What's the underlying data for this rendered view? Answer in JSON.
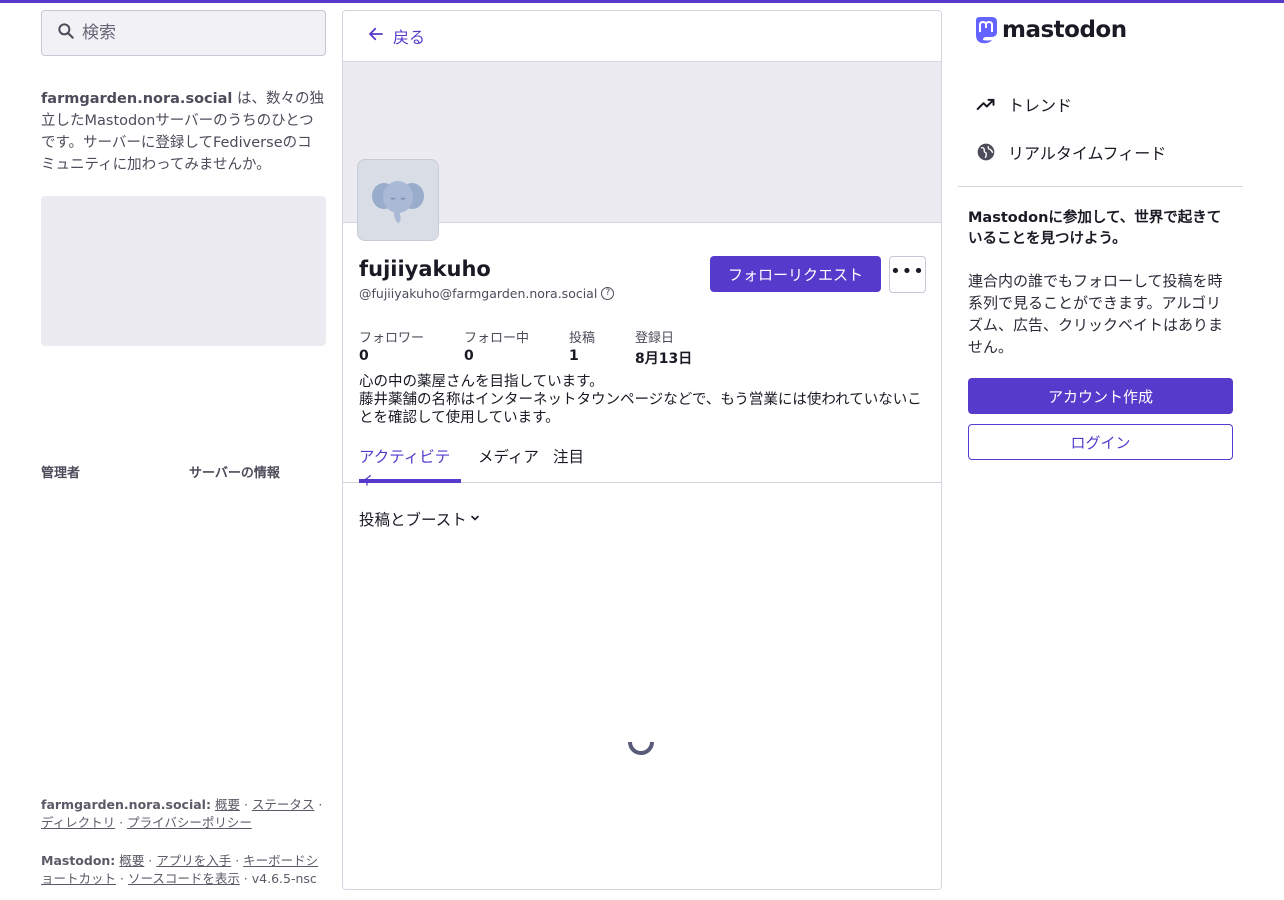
{
  "colors": {
    "accent": "#563acc",
    "panel": "#ecebf1",
    "border": "#d6d4df"
  },
  "search": {
    "placeholder": "検索",
    "icon": "search-icon"
  },
  "about": {
    "server": "farmgarden.nora.social",
    "text": " は、数々の独立したMastodonサーバーのうちのひとつです。サーバーに登録してFediverseのコミュニティに加わってみませんか。"
  },
  "labels": {
    "admin": "管理者",
    "server_info": "サーバーの情報"
  },
  "footer": {
    "server_host": "farmgarden.nora.social:",
    "server_links": [
      "概要",
      "ステータス",
      "ディレクトリ",
      "プライバシーポリシー"
    ],
    "mastodon_host": "Mastodon:",
    "mastodon_links": [
      "概要",
      "アプリを入手",
      "キーボードショートカット",
      "ソースコードを表示"
    ],
    "version": "v4.6.5-nsc"
  },
  "back": {
    "label": "戻る"
  },
  "profile": {
    "display_name": "fujiiyakuho",
    "handle": "@fujiiyakuho@farmgarden.nora.social",
    "follow_label": "フォローリクエスト",
    "more_label": "•••",
    "stats": {
      "followers_label": "フォロワー",
      "followers": "0",
      "following_label": "フォロー中",
      "following": "0",
      "posts_label": "投稿",
      "posts": "1",
      "joined_label": "登録日",
      "joined": "8月13日"
    },
    "bio_line1": "心の中の薬屋さんを目指しています。",
    "bio_line2": "藤井薬舗の名称はインターネットタウンページなどで、もう営業には使われていないことを確認して使用しています。"
  },
  "tabs": [
    {
      "label": "アクティビティ",
      "active": true
    },
    {
      "label": "メディア",
      "active": false
    },
    {
      "label": "注目",
      "active": false
    }
  ],
  "filter": {
    "label": "投稿とブースト"
  },
  "right": {
    "logo_text": "mastodon",
    "nav": [
      {
        "label": "トレンド",
        "icon": "trending-icon"
      },
      {
        "label": "リアルタイムフィード",
        "icon": "globe-icon"
      }
    ],
    "join_title": "Mastodonに参加して、世界で起きていることを見つけよう。",
    "join_text": "連合内の誰でもフォローして投稿を時系列で見ることができます。アルゴリズム、広告、クリックベイトはありません。",
    "create_account": "アカウント作成",
    "login": "ログイン"
  }
}
